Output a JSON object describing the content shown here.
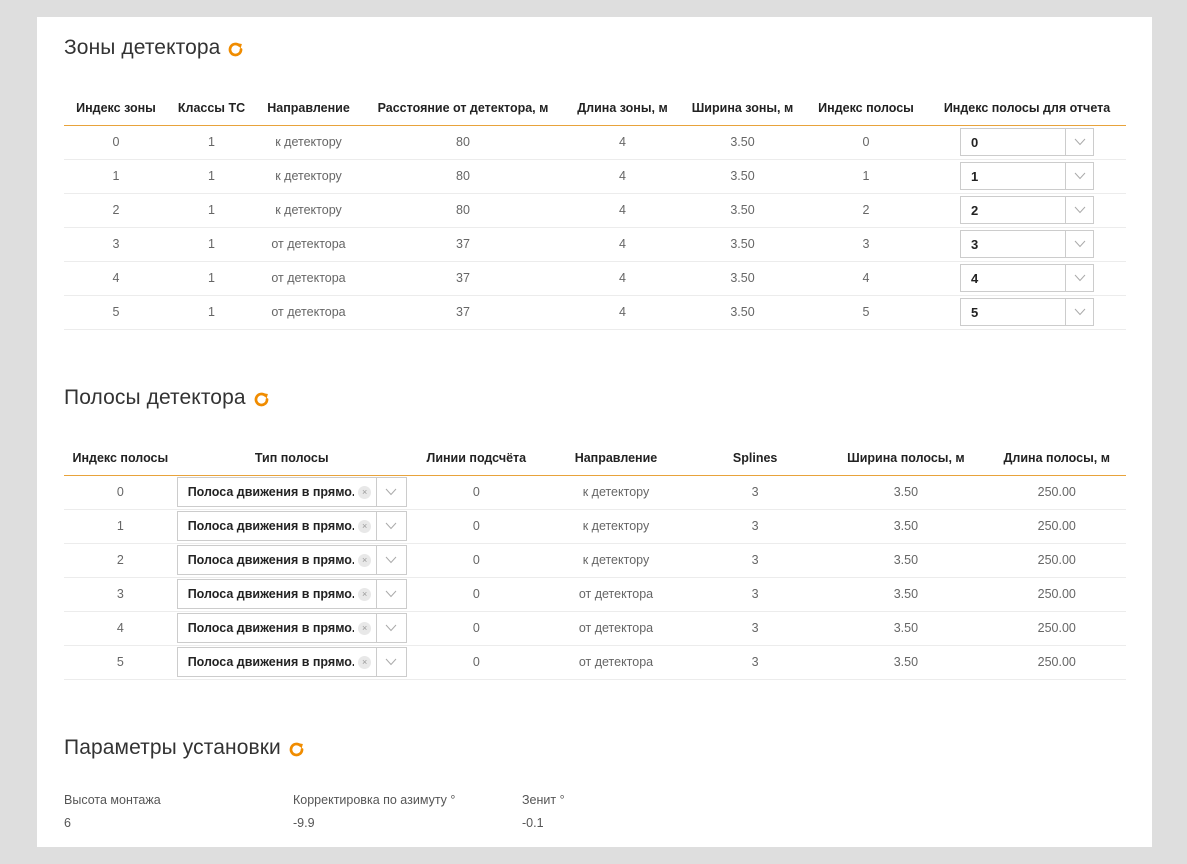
{
  "colors": {
    "accent": "#e8a33b",
    "icon": "#f08c00"
  },
  "zones": {
    "title": "Зоны детектора",
    "columns": [
      "Индекс зоны",
      "Классы ТС",
      "Направление",
      "Расстояние от детектора, м",
      "Длина зоны, м",
      "Ширина зоны, м",
      "Индекс полосы",
      "Индекс полосы для отчета"
    ],
    "rows": [
      [
        "0",
        "1",
        "к детектору",
        "80",
        "4",
        "3.50",
        "0",
        "0"
      ],
      [
        "1",
        "1",
        "к детектору",
        "80",
        "4",
        "3.50",
        "1",
        "1"
      ],
      [
        "2",
        "1",
        "к детектору",
        "80",
        "4",
        "3.50",
        "2",
        "2"
      ],
      [
        "3",
        "1",
        "от детектора",
        "37",
        "4",
        "3.50",
        "3",
        "3"
      ],
      [
        "4",
        "1",
        "от детектора",
        "37",
        "4",
        "3.50",
        "4",
        "4"
      ],
      [
        "5",
        "1",
        "от детектора",
        "37",
        "4",
        "3.50",
        "5",
        "5"
      ]
    ]
  },
  "lanes": {
    "title": "Полосы детектора",
    "columns": [
      "Индекс полосы",
      "Тип полосы",
      "Линии подсчёта",
      "Направление",
      "Splines",
      "Ширина полосы, м",
      "Длина полосы, м"
    ],
    "rows": [
      [
        "0",
        "Полоса движения в прямо...",
        "0",
        "к детектору",
        "3",
        "3.50",
        "250.00"
      ],
      [
        "1",
        "Полоса движения в прямо...",
        "0",
        "к детектору",
        "3",
        "3.50",
        "250.00"
      ],
      [
        "2",
        "Полоса движения в прямо...",
        "0",
        "к детектору",
        "3",
        "3.50",
        "250.00"
      ],
      [
        "3",
        "Полоса движения в прямо...",
        "0",
        "от детектора",
        "3",
        "3.50",
        "250.00"
      ],
      [
        "4",
        "Полоса движения в прямо...",
        "0",
        "от детектора",
        "3",
        "3.50",
        "250.00"
      ],
      [
        "5",
        "Полоса движения в прямо...",
        "0",
        "от детектора",
        "3",
        "3.50",
        "250.00"
      ]
    ]
  },
  "install": {
    "title": "Параметры установки",
    "params": [
      {
        "label": "Высота монтажа",
        "value": "6"
      },
      {
        "label": "Корректировка по азимуту °",
        "value": "-9.9"
      },
      {
        "label": "Зенит °",
        "value": "-0.1"
      }
    ]
  }
}
